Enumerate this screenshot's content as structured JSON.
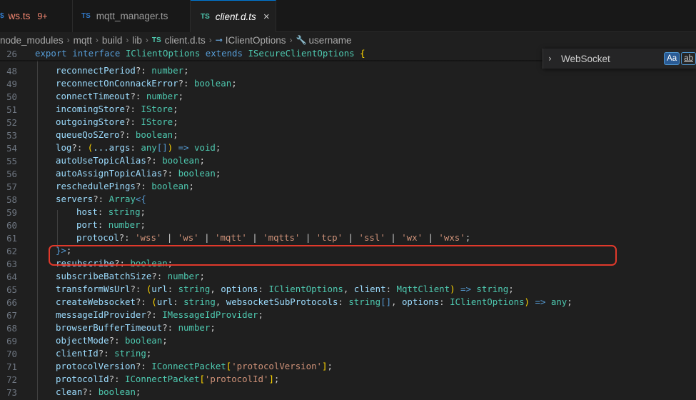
{
  "tabs": [
    {
      "icon": "TS",
      "label": "ws.ts",
      "badge": "9+"
    },
    {
      "icon": "TS",
      "label": "mqtt_manager.ts"
    },
    {
      "icon": "TS",
      "label": "client.d.ts",
      "close": "×"
    }
  ],
  "breadcrumb": {
    "items": [
      "node_modules",
      "mqtt",
      "build",
      "lib",
      "client.d.ts",
      "IClientOptions",
      "username"
    ],
    "ts_icon": "TS",
    "separator": "›"
  },
  "find": {
    "value": "WebSocket",
    "toggle": "›",
    "match_case": "Aa",
    "whole_word": "ab"
  },
  "sticky": {
    "line": "26",
    "export_kw": "export",
    "interface_kw": "interface",
    "name": "IClientOptions",
    "extends_kw": "extends",
    "base": "ISecureClientOptions",
    "brace": "{"
  },
  "lines": [
    {
      "n": "48"
    },
    {
      "n": "49"
    },
    {
      "n": "50"
    },
    {
      "n": "51"
    },
    {
      "n": "52"
    },
    {
      "n": "53"
    },
    {
      "n": "54"
    },
    {
      "n": "55"
    },
    {
      "n": "56"
    },
    {
      "n": "57"
    },
    {
      "n": "58"
    },
    {
      "n": "59"
    },
    {
      "n": "60"
    },
    {
      "n": "61"
    },
    {
      "n": "62"
    },
    {
      "n": "63"
    },
    {
      "n": "64"
    },
    {
      "n": "65"
    },
    {
      "n": "66"
    },
    {
      "n": "67"
    },
    {
      "n": "68"
    },
    {
      "n": "69"
    },
    {
      "n": "70"
    },
    {
      "n": "71"
    },
    {
      "n": "72"
    },
    {
      "n": "73"
    }
  ],
  "code": {
    "l48": {
      "prop": "reconnectPeriod",
      "type": "number"
    },
    "l49": {
      "prop": "reconnectOnConnackError",
      "type": "boolean"
    },
    "l50": {
      "prop": "connectTimeout",
      "type": "number"
    },
    "l51": {
      "prop": "incomingStore",
      "type": "IStore"
    },
    "l52": {
      "prop": "outgoingStore",
      "type": "IStore"
    },
    "l53": {
      "prop": "queueQoSZero",
      "type": "boolean"
    },
    "l54": {
      "prop": "log",
      "args": "...args",
      "argtype": "any",
      "ret": "void"
    },
    "l55": {
      "prop": "autoUseTopicAlias",
      "type": "boolean"
    },
    "l56": {
      "prop": "autoAssignTopicAlias",
      "type": "boolean"
    },
    "l57": {
      "prop": "reschedulePings",
      "type": "boolean"
    },
    "l58": {
      "prop": "servers",
      "type": "Array"
    },
    "l59": {
      "prop": "host",
      "type": "string"
    },
    "l60": {
      "prop": "port",
      "type": "number"
    },
    "l61": {
      "prop": "protocol",
      "v1": "'wss'",
      "v2": "'ws'",
      "v3": "'mqtt'",
      "v4": "'mqtts'",
      "v5": "'tcp'",
      "v6": "'ssl'",
      "v7": "'wx'",
      "v8": "'wxs'"
    },
    "l63": {
      "prop": "resubscribe",
      "type": "boolean"
    },
    "l64": {
      "prop": "subscribeBatchSize",
      "type": "number"
    },
    "l65": {
      "prop": "transformWsUrl",
      "a1": "url",
      "t1": "string",
      "a2": "options",
      "t2": "IClientOptions",
      "a3": "client",
      "t3": "MqttClient",
      "ret": "string"
    },
    "l66": {
      "prop": "createWebsocket",
      "a1": "url",
      "t1": "string",
      "a2": "websocketSubProtocols",
      "t2": "string",
      "a3": "options",
      "t3": "IClientOptions",
      "ret": "any"
    },
    "l67": {
      "prop": "messageIdProvider",
      "type": "IMessageIdProvider"
    },
    "l68": {
      "prop": "browserBufferTimeout",
      "type": "number"
    },
    "l69": {
      "prop": "objectMode",
      "type": "boolean"
    },
    "l70": {
      "prop": "clientId",
      "type": "string"
    },
    "l71": {
      "prop": "protocolVersion",
      "type": "IConnectPacket",
      "key": "'protocolVersion'"
    },
    "l72": {
      "prop": "protocolId",
      "type": "IConnectPacket",
      "key": "'protocolId'"
    },
    "l73": {
      "prop": "clean",
      "type": "boolean"
    }
  },
  "colors": {
    "keyword": "#569cd6",
    "type": "#4ec9b0",
    "property": "#9cdcfe",
    "string": "#ce9178",
    "annotation": "#e0392b"
  }
}
